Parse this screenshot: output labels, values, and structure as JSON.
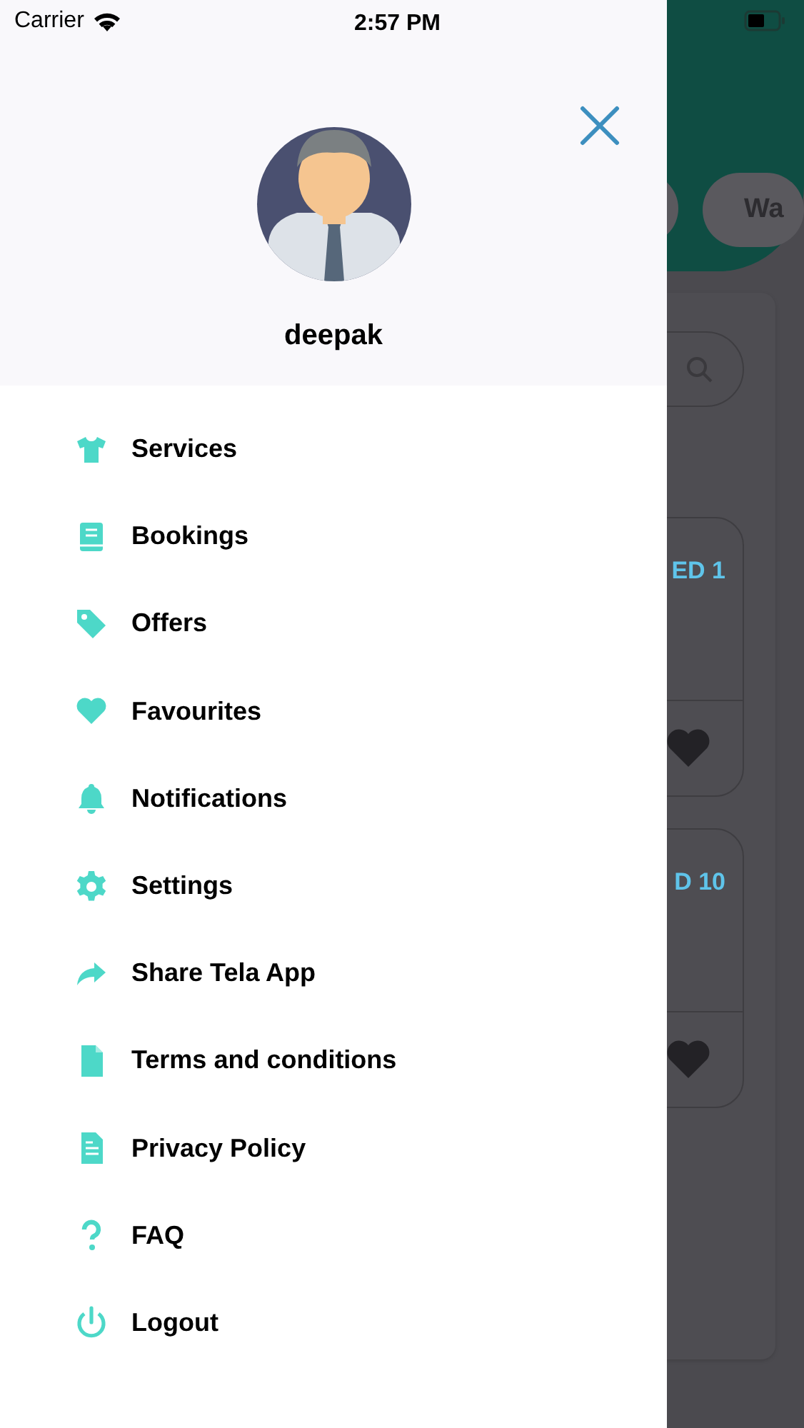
{
  "status_bar": {
    "carrier": "Carrier",
    "time": "2:57 PM"
  },
  "drawer": {
    "user_name": "deepak",
    "menu": [
      {
        "label": "Services"
      },
      {
        "label": "Bookings"
      },
      {
        "label": "Offers"
      },
      {
        "label": "Favourites"
      },
      {
        "label": "Notifications"
      },
      {
        "label": "Settings"
      },
      {
        "label": "Share Tela App"
      },
      {
        "label": "Terms and conditions"
      },
      {
        "label": "Privacy Policy"
      },
      {
        "label": "FAQ"
      },
      {
        "label": "Logout"
      }
    ]
  },
  "background": {
    "chip": "Wa",
    "cards": [
      {
        "title": "ED 1"
      },
      {
        "title": "D 10"
      }
    ]
  }
}
